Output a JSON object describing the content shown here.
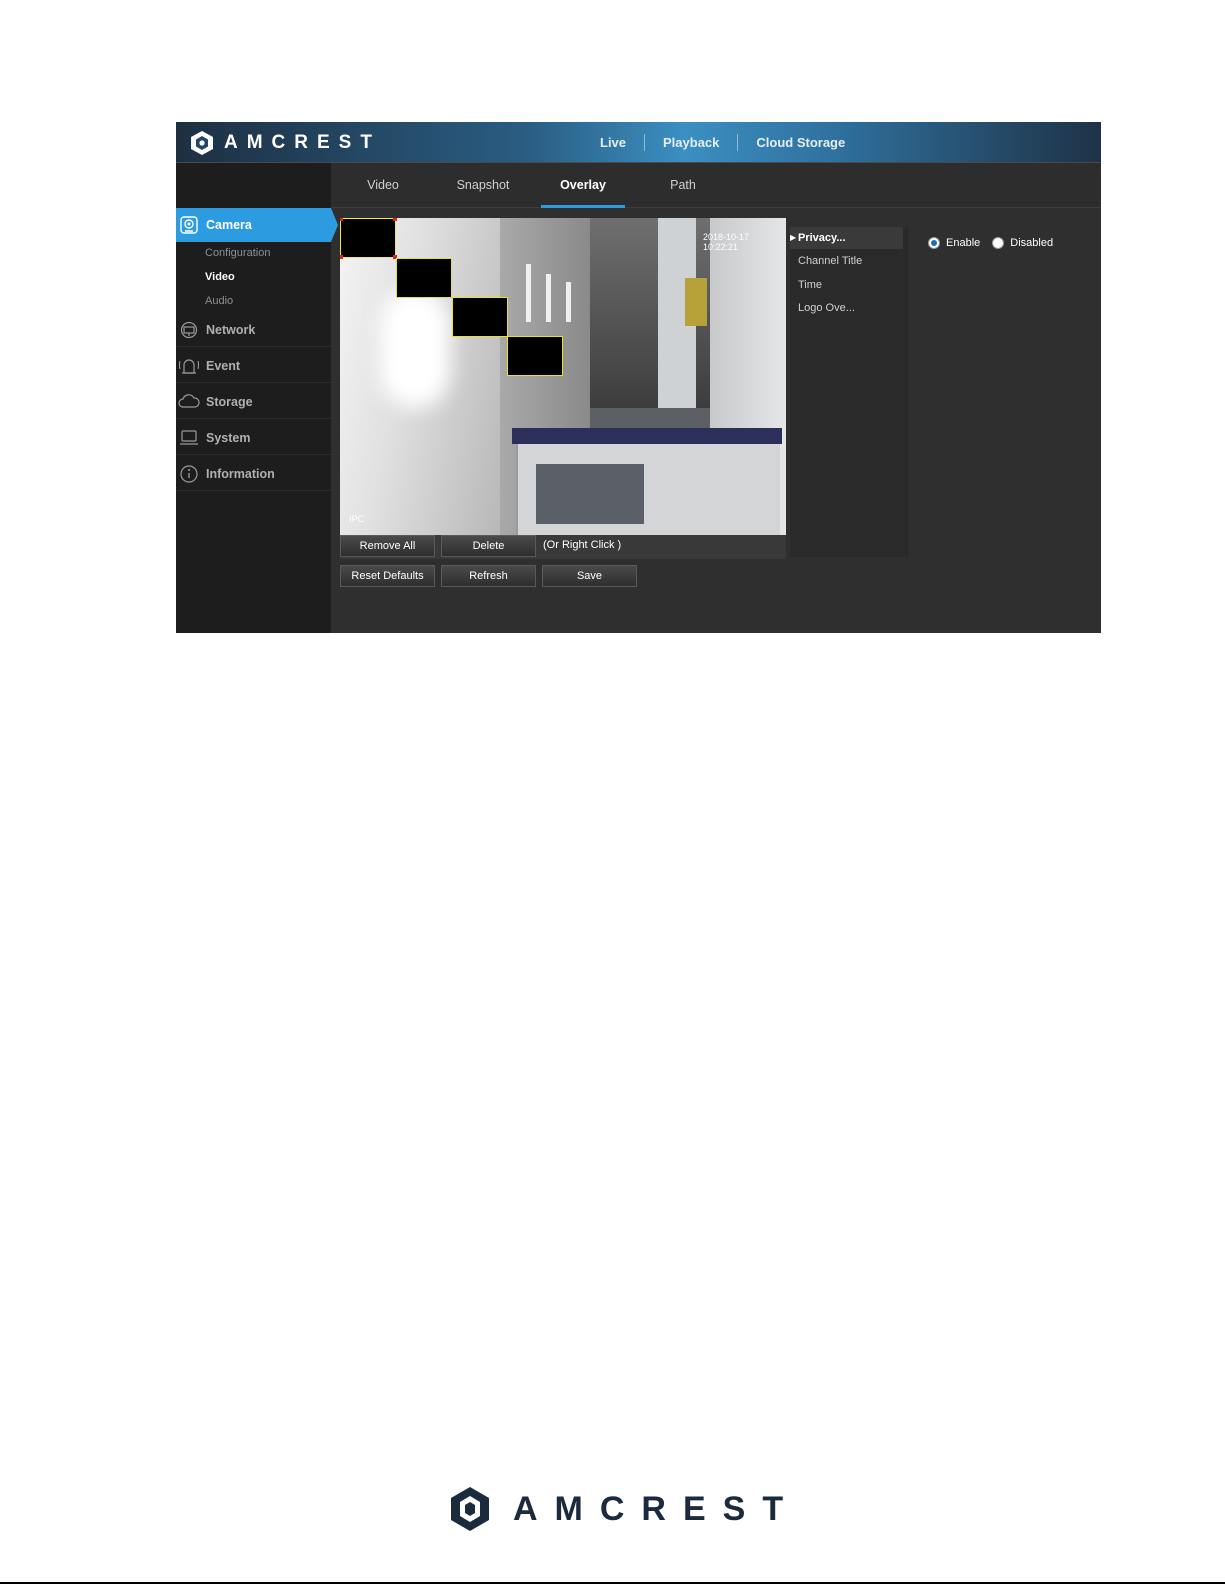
{
  "brand": {
    "name": "AMCREST",
    "accent": "#2c9be0"
  },
  "top_nav": {
    "items": [
      "Live",
      "Playback",
      "Cloud Storage"
    ]
  },
  "tabs": {
    "items": [
      "Video",
      "Snapshot",
      "Overlay",
      "Path"
    ],
    "active": "Overlay"
  },
  "sidebar": {
    "camera": "Camera",
    "camera_sub": [
      "Configuration",
      "Video",
      "Audio"
    ],
    "active_sub": "Video",
    "network": "Network",
    "event": "Event",
    "storage": "Storage",
    "system": "System",
    "information": "Information"
  },
  "preview": {
    "timestamp": "2018-10-17 10:22:21",
    "channel_name": "IPC",
    "privacy_mask_count": 4
  },
  "actions": {
    "remove_all": "Remove All",
    "delete": "Delete",
    "hint": "(Or Right Click )",
    "reset_defaults": "Reset Defaults",
    "refresh": "Refresh",
    "save": "Save"
  },
  "overlay_types": {
    "items": [
      "Privacy...",
      "Channel Title",
      "Time",
      "Logo Ove..."
    ],
    "active": "Privacy..."
  },
  "privacy": {
    "enable_label": "Enable",
    "disabled_label": "Disabled",
    "selected": "Enable"
  },
  "icons": {
    "camera": "camera-icon",
    "network": "network-icon",
    "event": "event-icon",
    "storage": "cloud-icon",
    "system": "monitor-icon",
    "information": "info-icon"
  }
}
